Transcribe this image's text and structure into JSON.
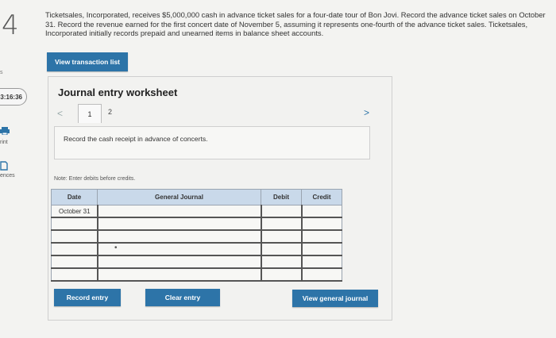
{
  "left_rail": {
    "question_number": "4",
    "rail_marker": "s",
    "timer": "03:16:36",
    "print_label": "rint",
    "references_label": "ences"
  },
  "question": {
    "text": "Ticketsales, Incorporated, receives $5,000,000 cash in advance ticket sales for a four-date tour of Bon Jovi. Record the advance ticket sales on October 31. Record the revenue earned for the first concert date of November 5, assuming it represents one-fourth of the advance ticket sales. Ticketsales, Incorporated initially records prepaid and unearned items in balance sheet accounts."
  },
  "buttons": {
    "view_transaction_list": "View transaction list",
    "record_entry": "Record entry",
    "clear_entry": "Clear entry",
    "view_general_journal": "View general journal"
  },
  "worksheet": {
    "title": "Journal entry worksheet",
    "prev": "<",
    "next": ">",
    "tabs": [
      "1",
      "2"
    ],
    "instruction": "Record the cash receipt in advance of concerts.",
    "note": "Note: Enter debits before credits."
  },
  "journal": {
    "headers": {
      "date": "Date",
      "general_journal": "General Journal",
      "debit": "Debit",
      "credit": "Credit"
    },
    "rows": [
      {
        "date": "October 31",
        "account": "",
        "debit": "",
        "credit": ""
      },
      {
        "date": "",
        "account": "",
        "debit": "",
        "credit": ""
      },
      {
        "date": "",
        "account": "",
        "debit": "",
        "credit": ""
      },
      {
        "date": "",
        "account": "",
        "debit": "",
        "credit": ""
      },
      {
        "date": "",
        "account": "",
        "debit": "",
        "credit": ""
      },
      {
        "date": "",
        "account": "",
        "debit": "",
        "credit": ""
      }
    ]
  },
  "colors": {
    "button_blue": "#2d74a8",
    "header_blue": "#c9d9ea",
    "background": "#f3f3f1"
  },
  "icons": [
    "printer-icon",
    "document-icon",
    "chevron-left-icon",
    "chevron-right-icon"
  ]
}
